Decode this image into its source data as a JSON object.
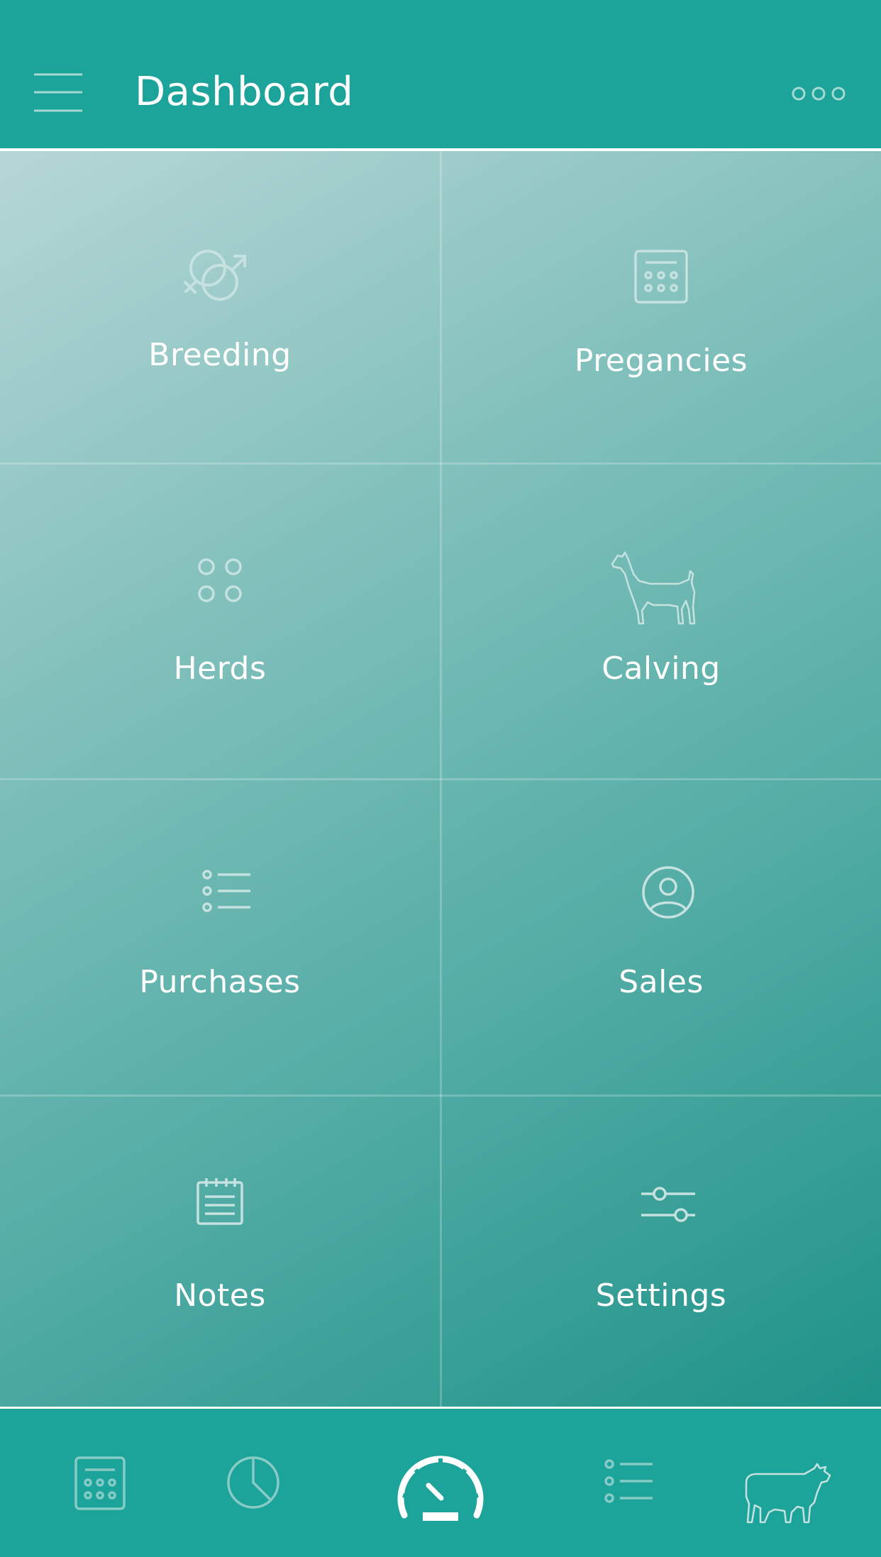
{
  "header": {
    "title": "Dashboard",
    "menu_icon": "hamburger-menu-icon",
    "more_icon": "more-dots-icon"
  },
  "tiles": [
    {
      "label": "Breeding",
      "icon": "gender-symbols-icon"
    },
    {
      "label": "Pregancies",
      "icon": "calendar-icon"
    },
    {
      "label": "Herds",
      "icon": "four-circles-icon"
    },
    {
      "label": "Calving",
      "icon": "calf-icon"
    },
    {
      "label": "Purchases",
      "icon": "list-icon"
    },
    {
      "label": "Sales",
      "icon": "user-circle-icon"
    },
    {
      "label": "Notes",
      "icon": "notepad-icon"
    },
    {
      "label": "Settings",
      "icon": "sliders-icon"
    }
  ],
  "bottom_nav": {
    "items": [
      {
        "icon": "calendar-icon"
      },
      {
        "icon": "pie-chart-icon"
      },
      {
        "icon": "speedometer-icon",
        "active": true
      },
      {
        "icon": "list-icon"
      },
      {
        "icon": "cow-icon"
      }
    ]
  },
  "colors": {
    "primary": "#1ca39a",
    "text": "#ffffff",
    "icon_muted": "#a6d8d4"
  }
}
